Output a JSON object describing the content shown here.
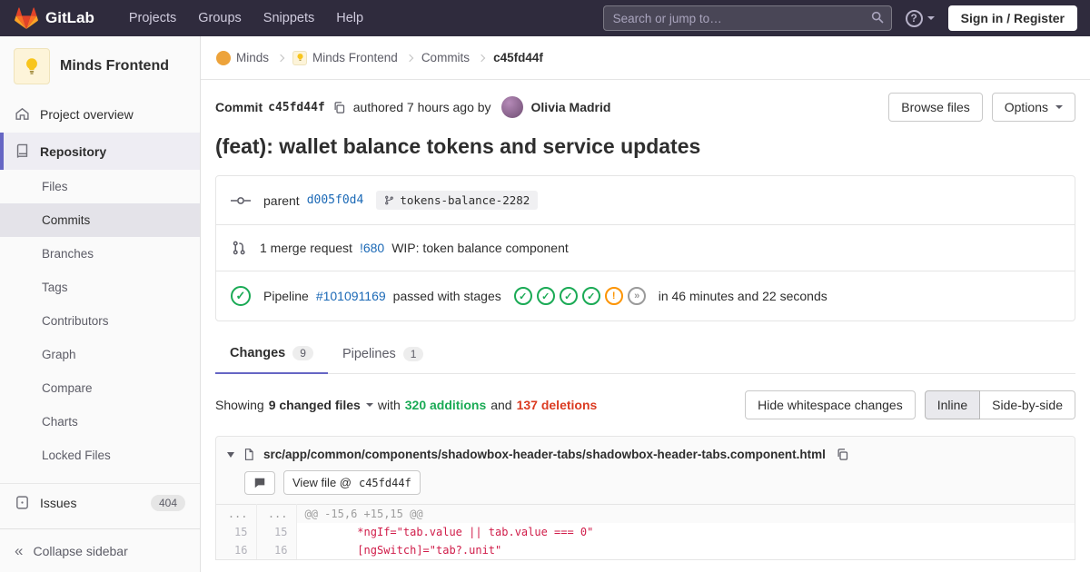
{
  "navbar": {
    "brand": "GitLab",
    "menu": [
      {
        "label": "Projects"
      },
      {
        "label": "Groups"
      },
      {
        "label": "Snippets"
      },
      {
        "label": "Help"
      }
    ],
    "search_placeholder": "Search or jump to…",
    "sign_in": "Sign in / Register"
  },
  "sidebar": {
    "project": "Minds Frontend",
    "overview": "Project overview",
    "repository": "Repository",
    "repo_items": [
      {
        "label": "Files"
      },
      {
        "label": "Commits"
      },
      {
        "label": "Branches"
      },
      {
        "label": "Tags"
      },
      {
        "label": "Contributors"
      },
      {
        "label": "Graph"
      },
      {
        "label": "Compare"
      },
      {
        "label": "Charts"
      },
      {
        "label": "Locked Files"
      }
    ],
    "issues": "Issues",
    "issues_count": "404",
    "collapse": "Collapse sidebar"
  },
  "breadcrumb": {
    "items": [
      {
        "label": "Minds"
      },
      {
        "label": "Minds Frontend"
      },
      {
        "label": "Commits"
      },
      {
        "label": "c45fd44f"
      }
    ]
  },
  "commit": {
    "label": "Commit",
    "sha": "c45fd44f",
    "authored": "authored 7 hours ago by",
    "author": "Olivia Madrid",
    "browse_files": "Browse files",
    "options": "Options",
    "title": "(feat): wallet balance tokens and service updates"
  },
  "details": {
    "parent_label": "parent",
    "parent_sha": "d005f0d4",
    "ref": "tokens-balance-2282",
    "mr_count": "1 merge request",
    "mr_id": "!680",
    "mr_title": "WIP: token balance component",
    "pipeline_label": "Pipeline",
    "pipeline_id": "#101091169",
    "pipeline_status": "passed with stages",
    "pipeline_duration": "in 46 minutes and 22 seconds",
    "stages": [
      "passed",
      "passed",
      "passed",
      "passed",
      "warning",
      "skipped"
    ]
  },
  "tabs": {
    "changes": "Changes",
    "changes_count": "9",
    "pipelines": "Pipelines",
    "pipelines_count": "1"
  },
  "summary": {
    "showing": "Showing",
    "files_dropdown": "9 changed files",
    "with": "with",
    "additions": "320 additions",
    "and": "and",
    "deletions": "137 deletions",
    "hide_whitespace": "Hide whitespace changes",
    "inline": "Inline",
    "side_by_side": "Side-by-side"
  },
  "diff": {
    "path": "src/app/common/components/shadowbox-header-tabs/shadowbox-header-tabs.component.html",
    "view_file_label": "View file @",
    "view_file_sha": "c45fd44f",
    "rows": [
      {
        "old": "...",
        "new": "...",
        "code": "@@ -15,6 +15,15 @@"
      },
      {
        "old": "15",
        "new": "15",
        "code": "        *ngIf=\"tab.value || tab.value === 0\""
      },
      {
        "old": "16",
        "new": "16",
        "code": "        [ngSwitch]=\"tab?.unit\""
      }
    ]
  },
  "icons": {
    "check": "✓",
    "warning": "!",
    "skipped": "»",
    "collapse": "«",
    "help": "?"
  },
  "colors": {
    "navbar_bg": "#2f2b3d",
    "link": "#1b69b6",
    "green": "#1aaa55",
    "orange": "#fc9403",
    "red": "#db3b21",
    "accent": "#6666c4"
  }
}
